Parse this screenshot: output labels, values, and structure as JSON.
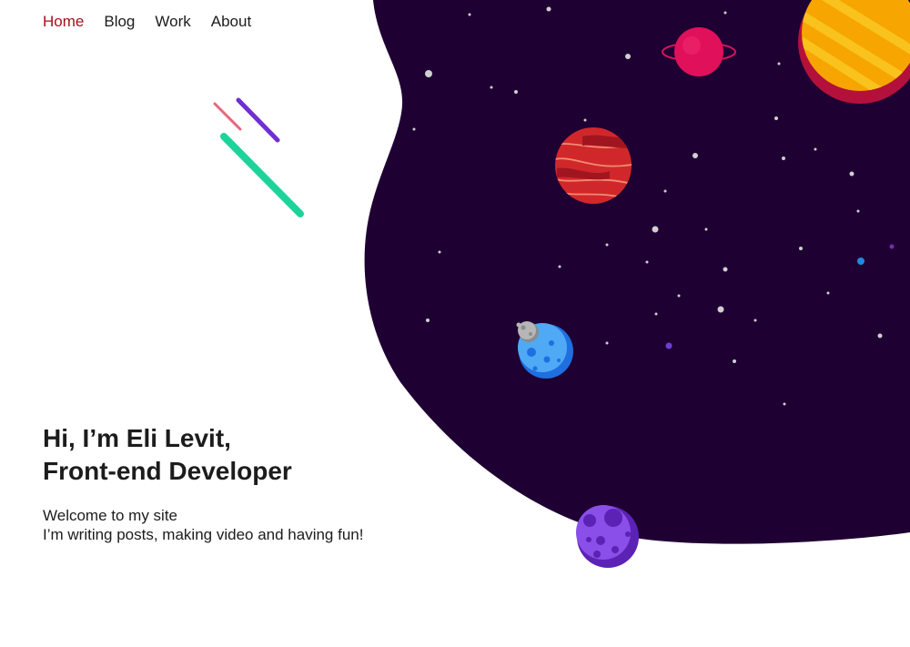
{
  "nav": {
    "items": [
      {
        "label": "Home",
        "active": true
      },
      {
        "label": "Blog",
        "active": false
      },
      {
        "label": "Work",
        "active": false
      },
      {
        "label": "About",
        "active": false
      }
    ],
    "active_color": "#a3121e"
  },
  "hero": {
    "title_line1": "Hi, I’m Eli Levit,",
    "title_line2": "Front-end Developer",
    "subtitle_line1": "Welcome to my site",
    "subtitle_line2": "I’m writing posts, making video and having fun!"
  },
  "illustration": {
    "space_color": "#1f0033",
    "elements": [
      "shooting-stars",
      "stars",
      "yellow-striped-planet",
      "pink-ringed-planet",
      "red-striped-planet",
      "blue-cratered-planet-with-moon",
      "purple-cratered-planet"
    ]
  }
}
